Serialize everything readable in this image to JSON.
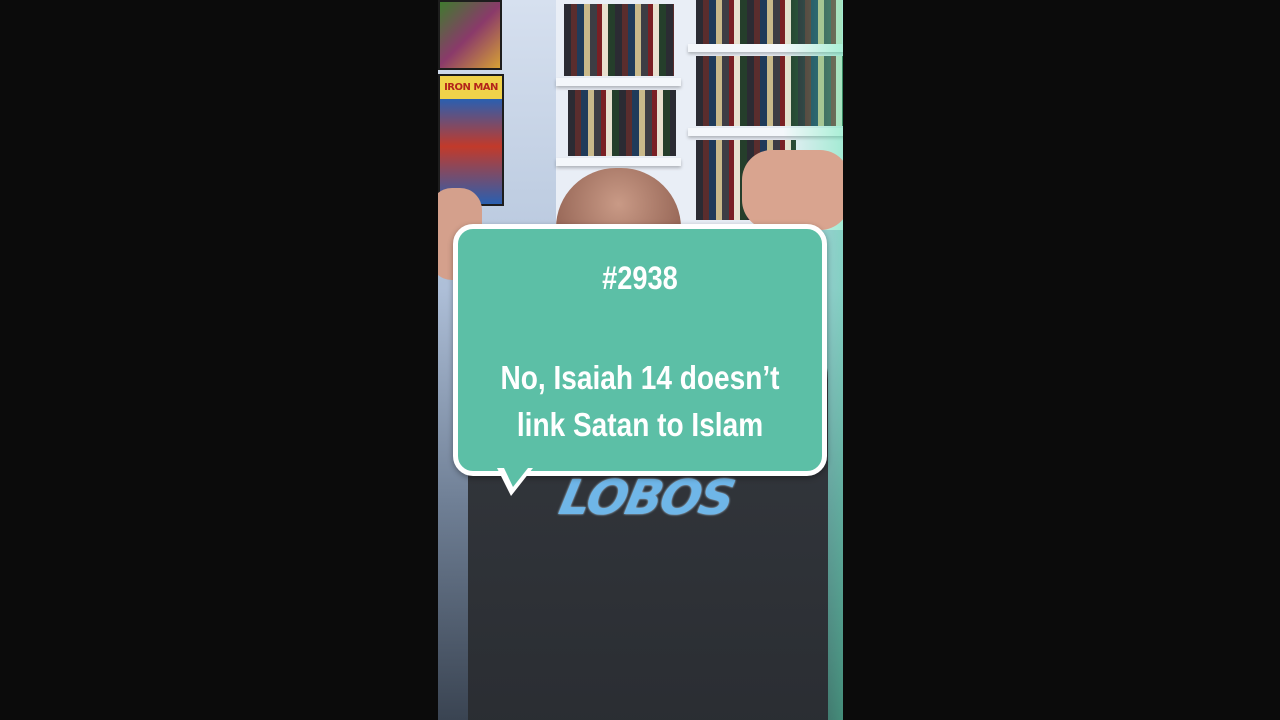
{
  "video": {
    "poster_title": "IRON MAN",
    "shirt_logo_text": "LOBOS"
  },
  "caption": {
    "number": "#2938",
    "line1": "No, Isaiah 14 doesn’t",
    "line2": "link Satan to Islam"
  },
  "colors": {
    "letterbox": "#0b0b0b",
    "bubble_fill": "#5cbfa6",
    "bubble_border": "#ffffff",
    "caption_text": "#ffffff"
  }
}
